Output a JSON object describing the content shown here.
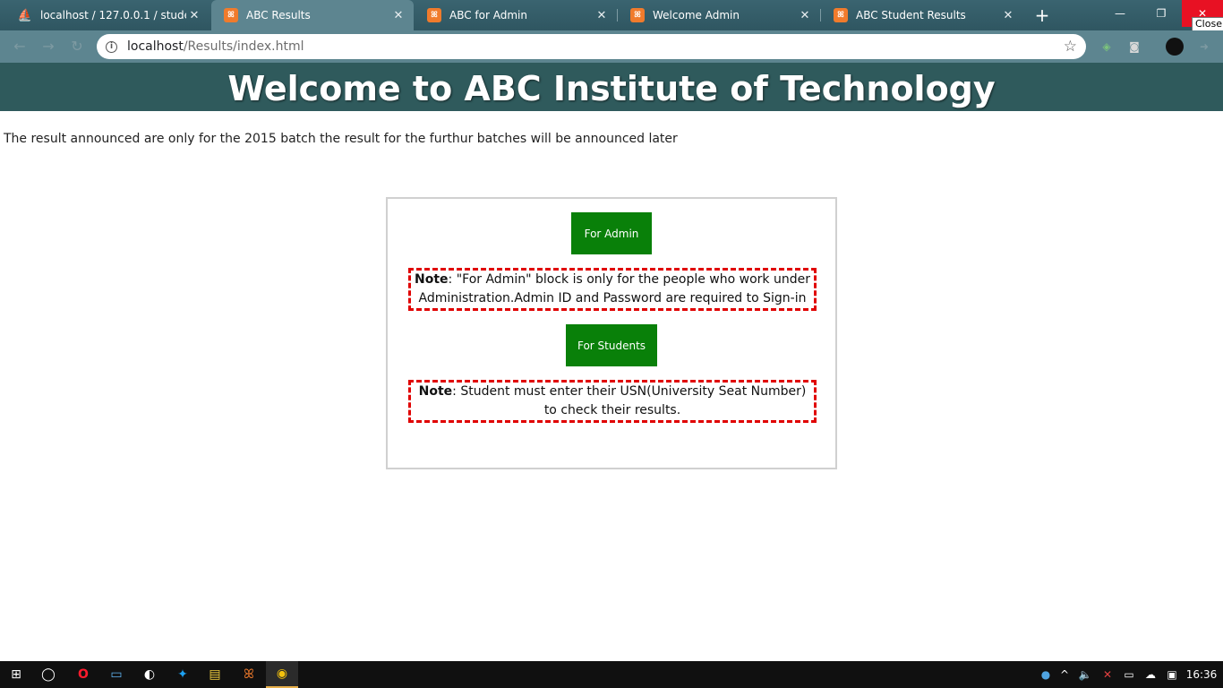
{
  "browser": {
    "tabs": [
      {
        "title": "localhost / 127.0.0.1 / studentr",
        "favicon": "phpmyadmin-icon",
        "active": false
      },
      {
        "title": "ABC Results",
        "favicon": "xampp-icon",
        "active": true
      },
      {
        "title": "ABC for Admin",
        "favicon": "xampp-icon",
        "active": false
      },
      {
        "title": "Welcome Admin",
        "favicon": "xampp-icon",
        "active": false
      },
      {
        "title": "ABC Student Results",
        "favicon": "xampp-icon",
        "active": false
      }
    ],
    "close_tooltip": "Close",
    "url_host": "localhost",
    "url_path": "/Results/index.html"
  },
  "page": {
    "heading": "Welcome to ABC Institute of Technology",
    "announcement": "The result announced are only for the 2015 batch the result for the furthur batches will be announced later",
    "admin_button": "For Admin",
    "admin_note_label": "Note",
    "admin_note_text": ": \"For Admin\" block is only for the people who work under Administration.Admin ID and Password are required to Sign-in",
    "students_button": "For Students",
    "students_note_label": "Note",
    "students_note_text": ": Student must enter their USN(University Seat Number) to check their results."
  },
  "taskbar": {
    "clock": "16:36"
  },
  "colors": {
    "banner": "#2f5a5c",
    "button_green": "#098009",
    "note_border": "#e00000",
    "tab_strip": "#3a6470"
  }
}
